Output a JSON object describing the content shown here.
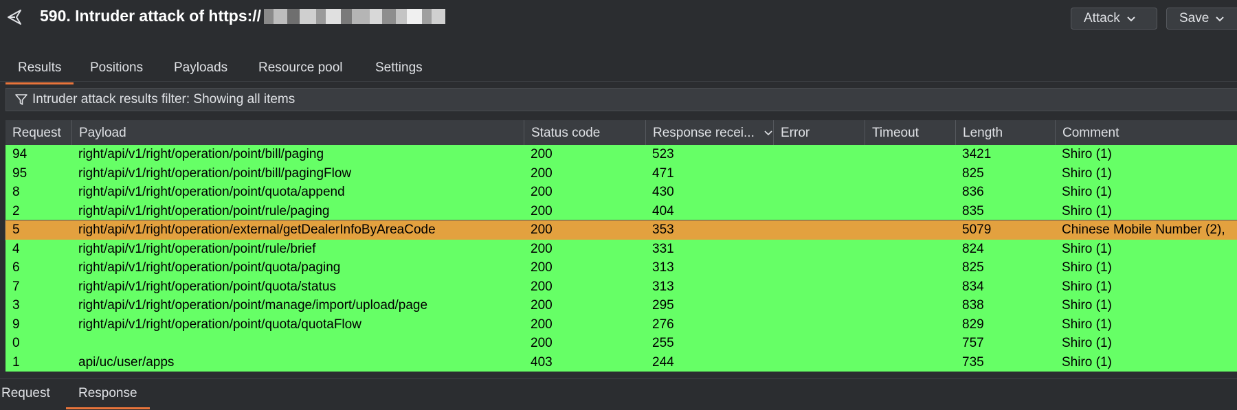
{
  "window": {
    "title": "590. Intruder attack of https://",
    "back_icon": "back-arrow-icon",
    "attack_label": "Attack",
    "save_label": "Save"
  },
  "tabs": [
    {
      "label": "Results",
      "active": true
    },
    {
      "label": "Positions",
      "active": false
    },
    {
      "label": "Payloads",
      "active": false
    },
    {
      "label": "Resource pool",
      "active": false
    },
    {
      "label": "Settings",
      "active": false
    }
  ],
  "filter": {
    "icon": "funnel-icon",
    "text": "Intruder attack results filter: Showing all items"
  },
  "table": {
    "columns": [
      "Request",
      "Payload",
      "Status code",
      "Response recei...",
      "Error",
      "Timeout",
      "Length",
      "Comment"
    ],
    "rows": [
      {
        "request": "94",
        "payload": "right/api/v1/right/operation/point/bill/paging",
        "status": "200",
        "response": "523",
        "error": "",
        "timeout": "",
        "length": "3421",
        "comment": "Shiro (1)"
      },
      {
        "request": "95",
        "payload": "right/api/v1/right/operation/point/bill/pagingFlow",
        "status": "200",
        "response": "471",
        "error": "",
        "timeout": "",
        "length": "825",
        "comment": "Shiro (1)"
      },
      {
        "request": "8",
        "payload": "right/api/v1/right/operation/point/quota/append",
        "status": "200",
        "response": "430",
        "error": "",
        "timeout": "",
        "length": "836",
        "comment": "Shiro (1)"
      },
      {
        "request": "2",
        "payload": "right/api/v1/right/operation/point/rule/paging",
        "status": "200",
        "response": "404",
        "error": "",
        "timeout": "",
        "length": "835",
        "comment": "Shiro (1)"
      },
      {
        "request": "5",
        "payload": "right/api/v1/right/operation/external/getDealerInfoByAreaCode",
        "status": "200",
        "response": "353",
        "error": "",
        "timeout": "",
        "length": "5079",
        "comment": "Chinese Mobile Number (2),",
        "selected": true
      },
      {
        "request": "4",
        "payload": "right/api/v1/right/operation/point/rule/brief",
        "status": "200",
        "response": "331",
        "error": "",
        "timeout": "",
        "length": "824",
        "comment": "Shiro (1)"
      },
      {
        "request": "6",
        "payload": "right/api/v1/right/operation/point/quota/paging",
        "status": "200",
        "response": "313",
        "error": "",
        "timeout": "",
        "length": "825",
        "comment": "Shiro (1)"
      },
      {
        "request": "7",
        "payload": "right/api/v1/right/operation/point/quota/status",
        "status": "200",
        "response": "313",
        "error": "",
        "timeout": "",
        "length": "834",
        "comment": "Shiro (1)"
      },
      {
        "request": "3",
        "payload": "right/api/v1/right/operation/point/manage/import/upload/page",
        "status": "200",
        "response": "295",
        "error": "",
        "timeout": "",
        "length": "838",
        "comment": "Shiro (1)"
      },
      {
        "request": "9",
        "payload": "right/api/v1/right/operation/point/quota/quotaFlow",
        "status": "200",
        "response": "276",
        "error": "",
        "timeout": "",
        "length": "829",
        "comment": "Shiro (1)"
      },
      {
        "request": "0",
        "payload": "",
        "status": "200",
        "response": "255",
        "error": "",
        "timeout": "",
        "length": "757",
        "comment": "Shiro (1)"
      },
      {
        "request": "1",
        "payload": "api/uc/user/apps",
        "status": "403",
        "response": "244",
        "error": "",
        "timeout": "",
        "length": "735",
        "comment": "Shiro (1)"
      }
    ]
  },
  "bottom_tabs": [
    {
      "label": "Request",
      "active": false
    },
    {
      "label": "Response",
      "active": true
    }
  ],
  "colors": {
    "row_highlight": "#66ff66",
    "row_selected": "#e3a13f",
    "accent": "#e8743b"
  }
}
